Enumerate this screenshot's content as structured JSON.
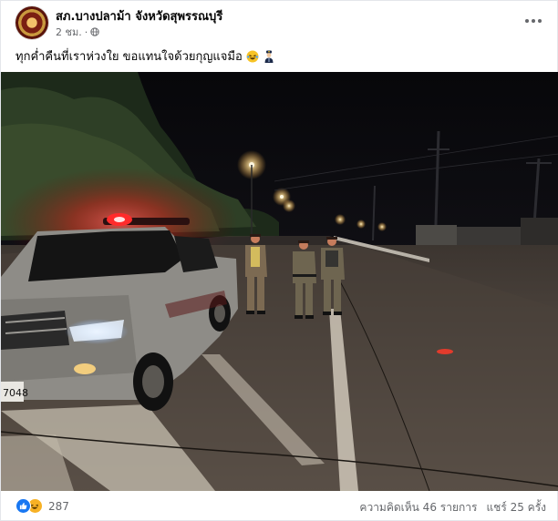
{
  "post": {
    "page_name": "สภ.บางปลาม้า จังหวัดสุพรรณบุรี",
    "time": "2 ชม.",
    "separator": "·",
    "privacy_icon": "globe-icon",
    "caption": "ทุกค่ำคืนที่เราห่วงใย ขอแทนใจด้วยกุญแจมือ",
    "caption_emojis": [
      "laughing-tears-emoji",
      "police-officer-emoji"
    ]
  },
  "photo": {
    "license_plate": "7048"
  },
  "footer": {
    "reaction_icons": [
      "like-icon",
      "haha-icon"
    ],
    "reaction_count": "287",
    "comments": "ความคิดเห็น 46 รายการ",
    "shares": "แชร์ 25 ครั้ง"
  },
  "colors": {
    "link_blue": "#1877f2",
    "secondary_text": "#65676b",
    "siren_red": "#ff2b2b"
  }
}
